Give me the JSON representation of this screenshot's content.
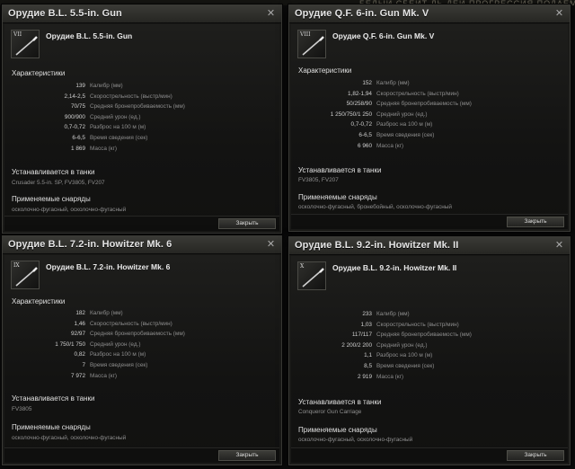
{
  "background": {
    "text": "БЕЛЫЙ  СБЕЙТ  ЛЬ ДЕЙ   ПРОГРЕССИЯ  ПОДАЕМАЯ"
  },
  "common": {
    "characteristics_heading": "Характеристики",
    "installed_heading": "Устанавливается в танки",
    "ammo_heading": "Применяемые снаряды",
    "close_button": "Закрыть",
    "close_icon": "✕",
    "stat_labels": [
      "Калибр (мм)",
      "Скорострельность (выстр/мин)",
      "Средняя бронепробиваемость (мм)",
      "Средний урон (ед.)",
      "Разброс на 100 м (м)",
      "Время сведения (сек)",
      "Масса (кг)"
    ]
  },
  "windows": [
    {
      "title": "Орудие B.L. 5.5-in. Gun",
      "name": "Орудие B.L. 5.5-in. Gun",
      "tier": "VII",
      "values": [
        "139",
        "2,14-2,5",
        "70/75",
        "900/900",
        "0,7-0,72",
        "6-6,5",
        "1 869"
      ],
      "tanks": "Crusader 5.5-in. SP, FV3805, FV207",
      "ammo": "осколочно-фугасный, осколочно-фугасный"
    },
    {
      "title": "Орудие Q.F. 6-in. Gun Mk. V",
      "name": "Орудие Q.F. 6-in. Gun Mk. V",
      "tier": "VIII",
      "values": [
        "152",
        "1,82-1,94",
        "50/258/90",
        "1 250/750/1 250",
        "0,7-0,72",
        "6-6,5",
        "6 960"
      ],
      "tanks": "FV3805, FV207",
      "ammo": "осколочно-фугасный, бронебойный, осколочно-фугасный"
    },
    {
      "title": "Орудие B.L. 7.2-in. Howitzer Mk. 6",
      "name": "Орудие B.L. 7.2-in. Howitzer Mk. 6",
      "tier": "IX",
      "values": [
        "182",
        "1,46",
        "92/97",
        "1 750/1 750",
        "0,82",
        "7",
        "7 972"
      ],
      "tanks": "FV3805",
      "ammo": "осколочно-фугасный, осколочно-фугасный"
    },
    {
      "title": "Орудие B.L. 9.2-in. Howitzer Mk. II",
      "name": "Орудие B.L. 9.2-in. Howitzer Mk. II",
      "tier": "X",
      "values": [
        "233",
        "1,03",
        "117/117",
        "2 200/2 200",
        "1,1",
        "8,5",
        "2 919"
      ],
      "tanks": "Conqueror Gun Carriage",
      "ammo": "осколочно-фугасный, осколочно-фугасный"
    }
  ]
}
